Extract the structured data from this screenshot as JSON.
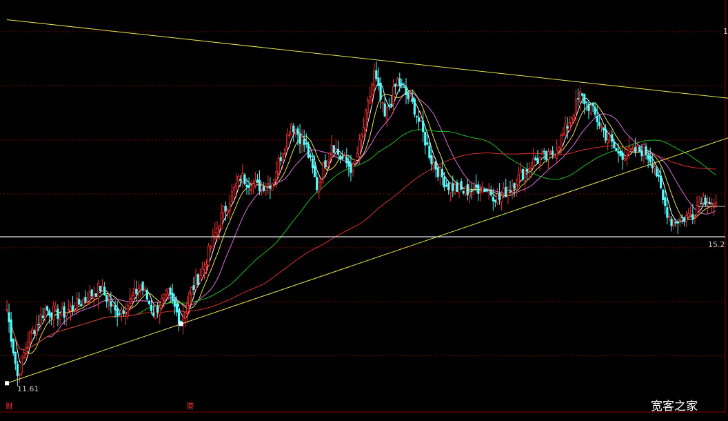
{
  "chart_data": {
    "type": "candlestick",
    "y_log": false,
    "ylim": [
      11.0,
      19.4
    ],
    "grid": true,
    "price_labels": {
      "low": "11.61",
      "current": "15.2",
      "high_partial": "1"
    },
    "event_markers": [
      "财",
      "港"
    ],
    "watermark": "宽客之家",
    "colors": {
      "background": "#000000",
      "up": "#ff3030",
      "down": "#54fcfc",
      "grid": "#8b0000",
      "trendline": "#e8e850",
      "horizontal_line": "#ffffff",
      "ma_fast": "#ffffff",
      "ma_mid": "#e8e850",
      "ma_slow": "#e070e0",
      "ma_long": "#20c020",
      "ma_longest": "#e03030"
    },
    "price_anchors": [
      [
        0,
        13.1
      ],
      [
        5,
        11.75
      ],
      [
        10,
        12.5
      ],
      [
        18,
        13.1
      ],
      [
        26,
        13.0
      ],
      [
        35,
        13.25
      ],
      [
        44,
        13.55
      ],
      [
        51,
        13.05
      ],
      [
        56,
        13.15
      ],
      [
        63,
        13.6
      ],
      [
        69,
        13.05
      ],
      [
        76,
        13.4
      ],
      [
        82,
        12.85
      ],
      [
        86,
        13.4
      ],
      [
        93,
        14.0
      ],
      [
        100,
        14.9
      ],
      [
        110,
        15.8
      ],
      [
        118,
        15.6
      ],
      [
        125,
        15.7
      ],
      [
        134,
        16.9
      ],
      [
        141,
        16.4
      ],
      [
        146,
        15.6
      ],
      [
        153,
        16.5
      ],
      [
        157,
        16.2
      ],
      [
        163,
        15.95
      ],
      [
        167,
        16.6
      ],
      [
        173,
        17.9
      ],
      [
        178,
        17.0
      ],
      [
        184,
        17.75
      ],
      [
        192,
        17.2
      ],
      [
        200,
        16.15
      ],
      [
        207,
        15.65
      ],
      [
        215,
        15.5
      ],
      [
        224,
        15.6
      ],
      [
        232,
        15.35
      ],
      [
        240,
        15.75
      ],
      [
        249,
        16.15
      ],
      [
        256,
        16.2
      ],
      [
        262,
        16.65
      ],
      [
        270,
        17.45
      ],
      [
        275,
        17.2
      ],
      [
        282,
        16.65
      ],
      [
        288,
        16.25
      ],
      [
        294,
        16.3
      ],
      [
        300,
        16.35
      ],
      [
        305,
        16.05
      ],
      [
        309,
        15.3
      ],
      [
        313,
        14.9
      ],
      [
        318,
        14.95
      ],
      [
        323,
        15.05
      ],
      [
        327,
        15.4
      ],
      [
        331,
        15.3
      ],
      [
        334,
        15.15
      ]
    ],
    "trendlines": [
      {
        "from": [
          0,
          19.0
        ],
        "to": [
          340,
          17.4
        ]
      },
      {
        "from": [
          0,
          11.6
        ],
        "to": [
          340,
          16.6
        ]
      }
    ],
    "horizontal_line": 14.58,
    "moving_averages": [
      {
        "color_key": "ma_fast",
        "period": 5
      },
      {
        "color_key": "ma_mid",
        "period": 10
      },
      {
        "color_key": "ma_slow",
        "period": 20
      },
      {
        "color_key": "ma_long",
        "period": 60
      },
      {
        "color_key": "ma_longest",
        "period": 120
      }
    ]
  }
}
